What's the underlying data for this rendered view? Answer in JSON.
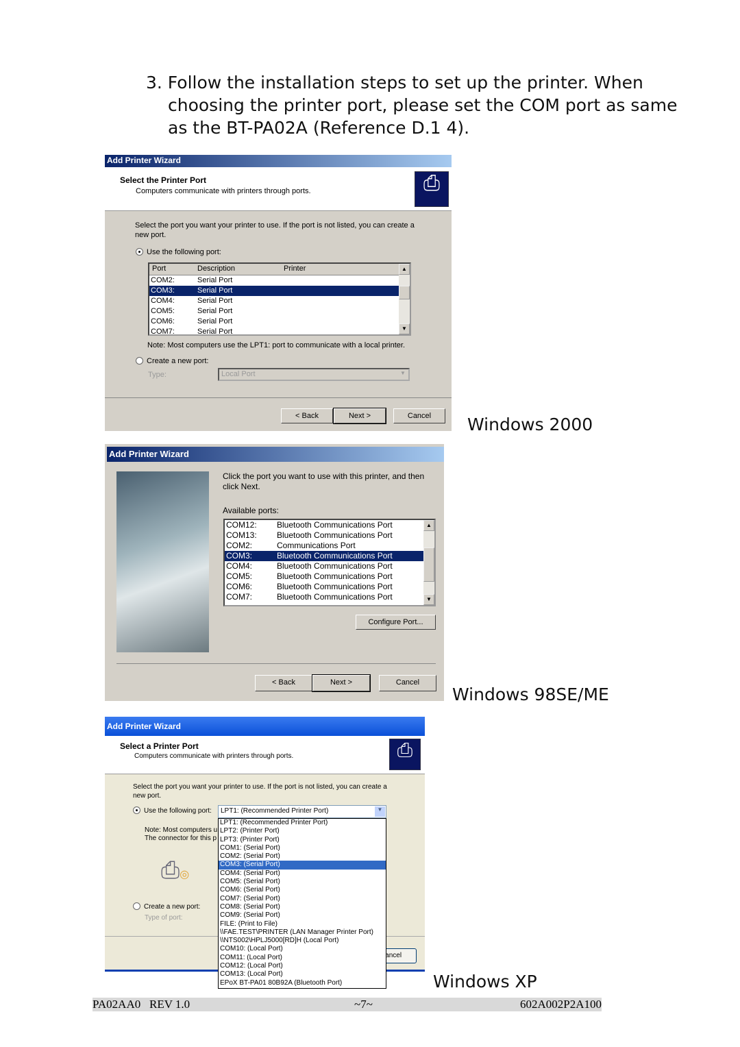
{
  "instruction": {
    "line1": "3. Follow the installation steps to set up the printer. When",
    "line2": "choosing the printer port, please set the COM port as same",
    "line3": "as the BT-PA02A (Reference D.1 4)."
  },
  "win2000": {
    "label": "Windows 2000",
    "title": "Add Printer Wizard",
    "heading": "Select the Printer Port",
    "subheading": "Computers communicate with printers through ports.",
    "intro": "Select the port you want your printer to use.  If the port is not listed, you can create a new port.",
    "use_port": "Use the following port:",
    "columns": [
      "Port",
      "Description",
      "Printer"
    ],
    "rows": [
      [
        "COM2:",
        "Serial Port"
      ],
      [
        "COM3:",
        "Serial Port"
      ],
      [
        "COM4:",
        "Serial Port"
      ],
      [
        "COM5:",
        "Serial Port"
      ],
      [
        "COM6:",
        "Serial Port"
      ],
      [
        "COM7:",
        "Serial Port"
      ]
    ],
    "selected": "COM3:",
    "note": "Note: Most computers use the LPT1: port to communicate with a local printer.",
    "create_port": "Create a new port:",
    "type_label": "Type:",
    "type_value": "Local Port",
    "back": "< Back",
    "next": "Next >",
    "cancel": "Cancel"
  },
  "win98": {
    "label": "Windows 98SE/ME",
    "title": "Add Printer Wizard",
    "intro": "Click the port you want to use with this printer, and then click Next.",
    "available": "Available ports:",
    "rows": [
      [
        "COM12:",
        "Bluetooth Communications Port"
      ],
      [
        "COM13:",
        "Bluetooth Communications Port"
      ],
      [
        "COM2:",
        "Communications Port"
      ],
      [
        "COM3:",
        "Bluetooth Communications Port"
      ],
      [
        "COM4:",
        "Bluetooth Communications Port"
      ],
      [
        "COM5:",
        "Bluetooth Communications Port"
      ],
      [
        "COM6:",
        "Bluetooth Communications Port"
      ],
      [
        "COM7:",
        "Bluetooth Communications Port"
      ]
    ],
    "selected": "COM3:",
    "configure": "Configure Port...",
    "back": "< Back",
    "next": "Next >",
    "cancel": "Cancel"
  },
  "winxp": {
    "label": "Windows XP",
    "title": "Add Printer Wizard",
    "heading": "Select a Printer Port",
    "subheading": "Computers communicate with printers through ports.",
    "intro": "Select the port you want your printer to use.  If the port is not listed, you can create a new port.",
    "use_port": "Use the following port:",
    "combo_value": "LPT1: (Recommended Printer Port)",
    "note1": "Note: Most computers u",
    "note2": "The connector for this p",
    "create_port": "Create a new port:",
    "type_label": "Type of port:",
    "cancel": "Cancel",
    "options": [
      "LPT1: (Recommended Printer Port)",
      "LPT2: (Printer Port)",
      "LPT3: (Printer Port)",
      "COM1: (Serial Port)",
      "COM2: (Serial Port)",
      "COM3: (Serial Port)",
      "COM4: (Serial Port)",
      "COM5: (Serial Port)",
      "COM6: (Serial Port)",
      "COM7: (Serial Port)",
      "COM8: (Serial Port)",
      "COM9: (Serial Port)",
      "FILE: (Print to File)",
      "\\\\FAE.TEST\\PRINTER (LAN Manager Printer Port)",
      "\\\\NTS002\\HPLJ5000[RD]H (Local Port)",
      "COM10: (Local Port)",
      "COM11: (Local Port)",
      "COM12: (Local Port)",
      "COM13: (Local Port)",
      "EPoX BT-PA01 80B92A (Bluetooth Port)"
    ],
    "selected_index": 5
  },
  "footer": {
    "left": "PA02AA0   REV 1.0",
    "center": "~7~",
    "right": "602A002P2A100"
  },
  "colors": {
    "selection": "#0a246a",
    "xp_selection": "#316ac5",
    "dialog_bg": "#d4d0c8",
    "xp_bg": "#ece9d8"
  }
}
